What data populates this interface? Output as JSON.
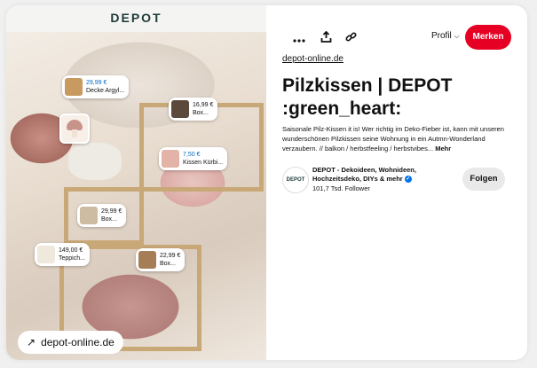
{
  "image": {
    "brand_logo": "DEPOT",
    "site_link": "depot-online.de",
    "product_tags": [
      {
        "price": "29,99 €",
        "name": "Decke Argyl...",
        "price_color": "#0a66c2",
        "thumb_color": "#c89a60"
      },
      {
        "price": "16,99 €",
        "name": "Box...",
        "price_color": "#111111",
        "thumb_color": "#5b4a3c"
      },
      {
        "price": "7,50 €",
        "name": "Kissen Kürbi...",
        "price_color": "#0a66c2",
        "thumb_color": "#e2b3a6"
      },
      {
        "price": "29,99 €",
        "name": "Box...",
        "price_color": "#111111",
        "thumb_color": "#cdbba2"
      },
      {
        "price": "149,00 €",
        "name": "Teppich...",
        "price_color": "#111111",
        "thumb_color": "#efe8dc"
      },
      {
        "price": "22,99 €",
        "name": "Box...",
        "price_color": "#111111",
        "thumb_color": "#a57e58"
      }
    ]
  },
  "toolbar": {
    "more_icon": "more-dots-icon",
    "share_icon": "share-icon",
    "link_icon": "link-icon",
    "profile_label": "Profil",
    "save_label": "Merken",
    "accent": "#e60023"
  },
  "pin": {
    "domain": "depot-online.de",
    "title": "Pilzkissen | DEPOT :green_heart:",
    "description": "Saisonale Pilz-Kissen it is! Wer richtig im Deko-Fieber ist, kann mit unseren wunderschönen Pilzkissen seine Wohnung in ein Autmn-Wonderland verzaubern. // balkon / herbstfeeling / herbstvibes...",
    "more_label": "Mehr"
  },
  "creator": {
    "avatar_text": "DEPOT",
    "name": "DEPOT - Dekoideen, Wohnideen, Hochzeitsdeko, DIYs & mehr",
    "followers": "101,7 Tsd. Follower",
    "follow_label": "Folgen"
  }
}
